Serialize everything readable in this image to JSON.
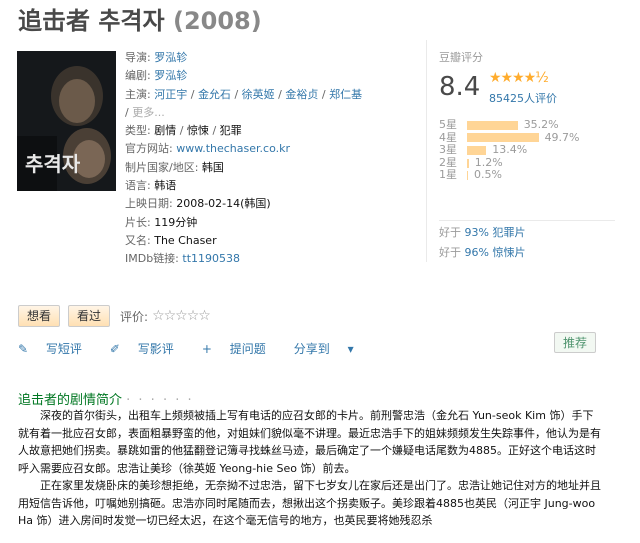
{
  "title": {
    "cn": "追击者 추격자",
    "year": "(2008)"
  },
  "info": {
    "director_label": "导演:",
    "director": "罗泓轸",
    "writer_label": "编剧:",
    "writer": "罗泓轸",
    "cast_label": "主演:",
    "cast": [
      "河正宇",
      "金允石",
      "徐英姬",
      "金裕贞",
      "郑仁基"
    ],
    "cast_more": "更多...",
    "genre_label": "类型:",
    "genres": [
      "剧情",
      "惊悚",
      "犯罪"
    ],
    "site_label": "官方网站:",
    "site": "www.thechaser.co.kr",
    "country_label": "制片国家/地区:",
    "country": "韩国",
    "lang_label": "语言:",
    "lang": "韩语",
    "date_label": "上映日期:",
    "date": "2008-02-14(韩国)",
    "runtime_label": "片长:",
    "runtime": "119分钟",
    "aka_label": "又名:",
    "aka": "The Chaser",
    "imdb_label": "IMDb链接:",
    "imdb": "tt1190538"
  },
  "rating": {
    "label": "豆瓣评分",
    "score": "8.4",
    "stars": "★★★★½",
    "votes": "85425人评价",
    "distribution": [
      {
        "star": "5星",
        "pct": "35.2%",
        "value": 35.2
      },
      {
        "star": "4星",
        "pct": "49.7%",
        "value": 49.7
      },
      {
        "star": "3星",
        "pct": "13.4%",
        "value": 13.4
      },
      {
        "star": "2星",
        "pct": "1.2%",
        "value": 1.2
      },
      {
        "star": "1星",
        "pct": "0.5%",
        "value": 0.5
      }
    ],
    "better": [
      {
        "prefix": "好于",
        "text": "93% 犯罪片"
      },
      {
        "prefix": "好于",
        "text": "96% 惊悚片"
      }
    ]
  },
  "actions": {
    "want": "想看",
    "seen": "看过",
    "rate_label": "评价:",
    "rate_stars": "☆☆☆☆☆"
  },
  "tools": {
    "short_review": "写短评",
    "review": "写影评",
    "question": "提问题",
    "share": "分享到"
  },
  "recommend": "推荐",
  "summary": {
    "heading": "追击者的剧情简介",
    "dots": "· · · · · ·",
    "p1": "深夜的首尔街头，出租车上频频被插上写有电话的应召女郎的卡片。前刑警忠浩（金允石 Yun-seok Kim 饰）手下就有着一批应召女郎，表面粗暴野蛮的他，对姐妹们貌似毫不讲理。最近忠浩手下的姐妹频频发生失踪事件，他认为是有人故意把她们拐卖。暴跳如雷的他猛翻登记簿寻找蛛丝马迹，最后确定了一个嫌疑电话尾数为4885。正好这个电话这时呼入需要应召女郎。忠浩让美珍（徐英姬 Yeong-hie Seo 饰）前去。",
    "p2": "正在家里发烧卧床的美珍想拒绝，无奈拗不过忠浩，留下七岁女儿在家后还是出门了。忠浩让她记住对方的地址并且用短信告诉他，叮嘱她别搞砸。忠浩亦同时尾随而去，想揪出这个拐卖贩子。美珍跟着4885也英民（河正宇 Jung-woo Ha 饰）进入房间时发觉一切已经太迟，在这个毫无信号的地方，也英民要将她残忍杀"
  }
}
